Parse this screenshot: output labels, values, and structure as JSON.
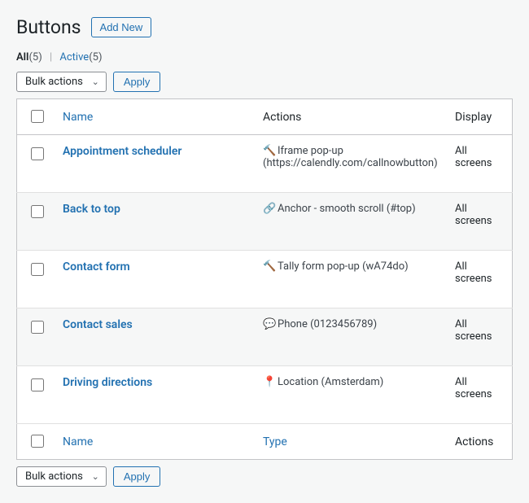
{
  "header": {
    "title": "Buttons",
    "add_new": "Add New"
  },
  "filters": {
    "all_label": "All",
    "all_count": "(5)",
    "active_label": "Active",
    "active_count": "(5)"
  },
  "bulk": {
    "label": "Bulk actions",
    "apply": "Apply"
  },
  "columns": {
    "name": "Name",
    "actions": "Actions",
    "display": "Display",
    "type": "Type"
  },
  "rows": [
    {
      "name": "Appointment scheduler",
      "icon": "🔨",
      "action": "Iframe pop-up (https://calendly.com/callnowbutton)",
      "display": "All screens"
    },
    {
      "name": "Back to top",
      "icon": "🔗",
      "action": "Anchor - smooth scroll (#top)",
      "display": "All screens"
    },
    {
      "name": "Contact form",
      "icon": "🔨",
      "action": "Tally form pop-up (wA74do)",
      "display": "All screens"
    },
    {
      "name": "Contact sales",
      "icon": "💬",
      "action": "Phone (0123456789)",
      "display": "All screens"
    },
    {
      "name": "Driving directions",
      "icon": "📍",
      "action": "Location (Amsterdam)",
      "display": "All screens"
    }
  ]
}
